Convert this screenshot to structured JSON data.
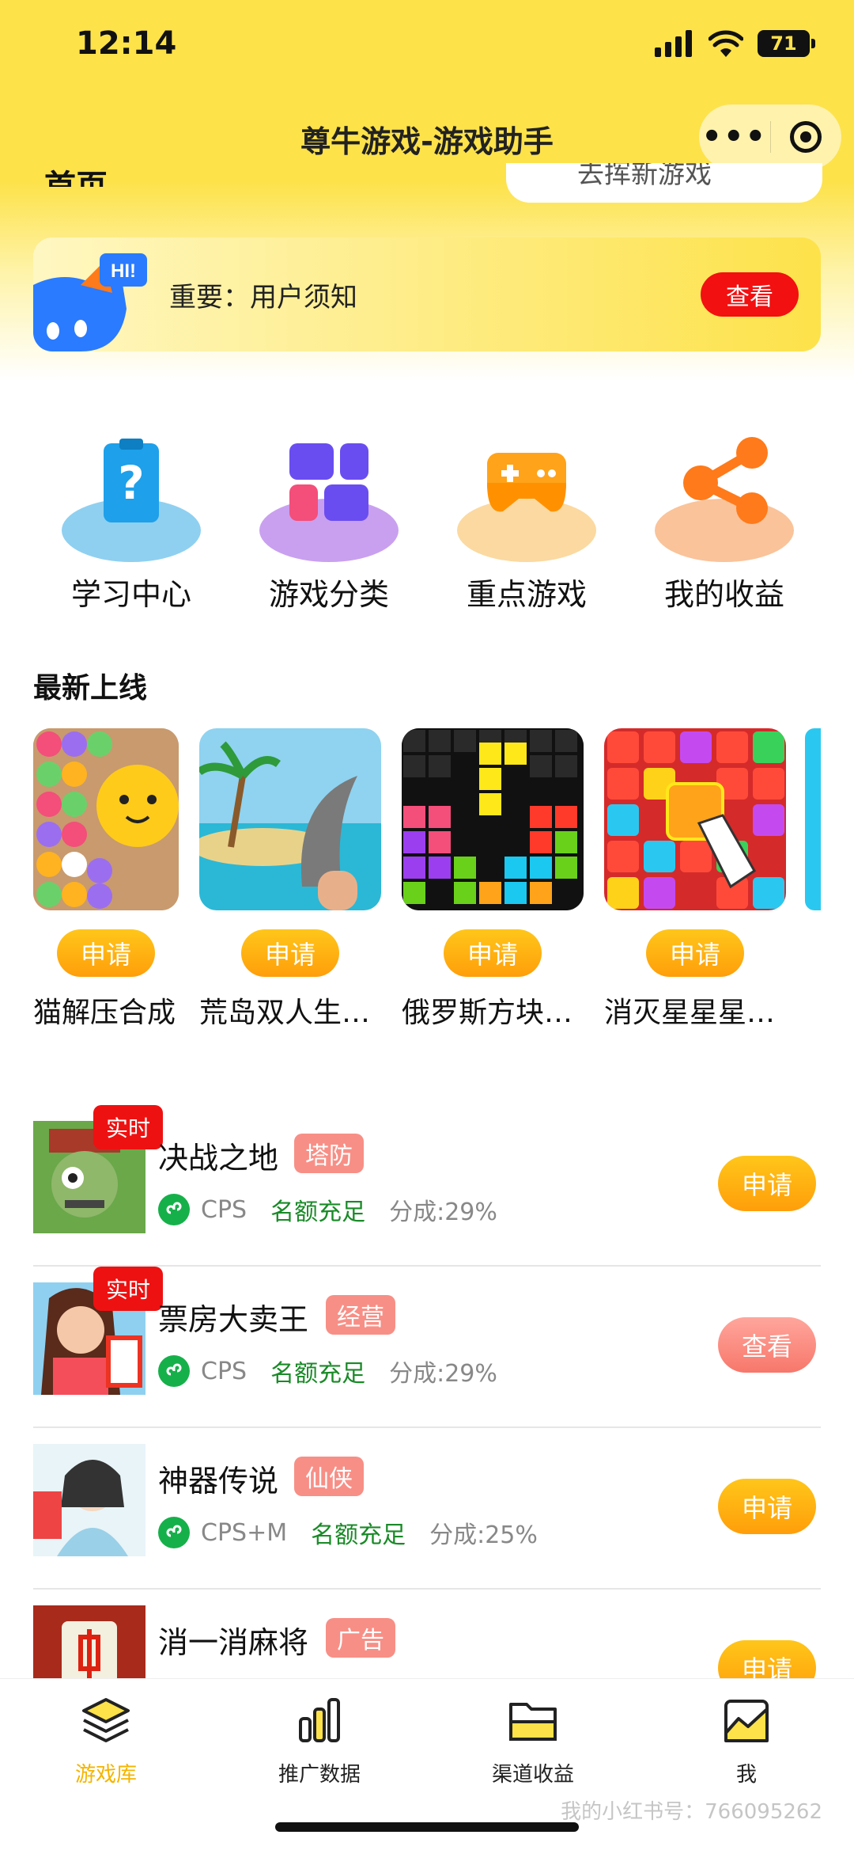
{
  "status": {
    "time": "12:14",
    "battery": "71"
  },
  "nav": {
    "title": "尊牛游戏-游戏助手",
    "more_icon": "•••"
  },
  "header_cut": {
    "title": "首页",
    "search_placeholder": "去挥新游戏"
  },
  "notice": {
    "text": "重要：用户须知",
    "button": "查看"
  },
  "quick": [
    {
      "label": "学习中心",
      "icon": "question-clipboard-icon"
    },
    {
      "label": "游戏分类",
      "icon": "category-grid-icon"
    },
    {
      "label": "重点游戏",
      "icon": "gamepad-icon"
    },
    {
      "label": "我的收益",
      "icon": "share-nodes-icon"
    }
  ],
  "new_section": {
    "title": "最新上线",
    "apply_label": "申请",
    "games": [
      {
        "name": "猫解压合成"
      },
      {
        "name": "荒岛双人生…"
      },
      {
        "name": "俄罗斯方块…"
      },
      {
        "name": "消灭星星星…"
      }
    ]
  },
  "list": [
    {
      "badge": "实时",
      "name": "决战之地",
      "tag": "塔防",
      "type": "CPS",
      "quota": "名额充足",
      "share": "分成:29%",
      "button": "申请",
      "button_style": "apply"
    },
    {
      "badge": "实时",
      "name": "票房大卖王",
      "tag": "经营",
      "type": "CPS",
      "quota": "名额充足",
      "share": "分成:29%",
      "button": "查看",
      "button_style": "view"
    },
    {
      "badge": "",
      "name": "神器传说",
      "tag": "仙侠",
      "type": "CPS+M",
      "quota": "名额充足",
      "share": "分成:25%",
      "button": "申请",
      "button_style": "apply"
    },
    {
      "badge": "",
      "name": "消一消麻将",
      "tag": "广告",
      "type": "",
      "quota": "",
      "share": "",
      "button": "申请",
      "button_style": "apply"
    }
  ],
  "tabbar": [
    {
      "label": "游戏库",
      "icon": "layers-icon",
      "active": true
    },
    {
      "label": "推广数据",
      "icon": "bar-chart-icon",
      "active": false
    },
    {
      "label": "渠道收益",
      "icon": "folder-icon",
      "active": false
    },
    {
      "label": "我",
      "icon": "trend-image-icon",
      "active": false
    }
  ],
  "watermark": "我的小红书号：766095262",
  "colors": {
    "brand_yellow": "#fde24a",
    "badge_red": "#ee1111",
    "tag_pink": "#f78f86",
    "quota_green": "#1a8a28",
    "active_tab": "#f4b400"
  }
}
